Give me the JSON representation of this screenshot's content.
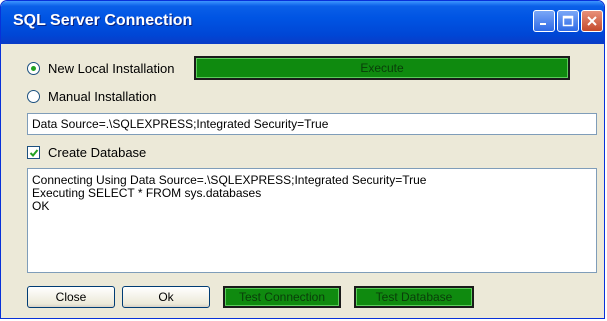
{
  "window": {
    "title": "SQL Server Connection"
  },
  "options": {
    "new_local_label": "New Local Installation",
    "manual_label": "Manual Installation",
    "selected": "new_local"
  },
  "execute_button": {
    "label": "Execute"
  },
  "connection_string": {
    "value": "Data Source=.\\SQLEXPRESS;Integrated Security=True"
  },
  "create_database": {
    "label": "Create Database",
    "checked": true
  },
  "log": {
    "lines": [
      "Connecting Using Data Source=.\\SQLEXPRESS;Integrated Security=True",
      "Executing SELECT * FROM sys.databases",
      "OK"
    ]
  },
  "buttons": {
    "close": "Close",
    "ok": "Ok",
    "test_connection": "Test Connection",
    "test_database": "Test Database"
  },
  "colors": {
    "titlebar": "#0054e3",
    "green_button": "#0f8a0f",
    "background": "#ece9d8"
  },
  "icons": {
    "minimize": "minimize-icon",
    "maximize": "maximize-icon",
    "close": "close-icon"
  }
}
